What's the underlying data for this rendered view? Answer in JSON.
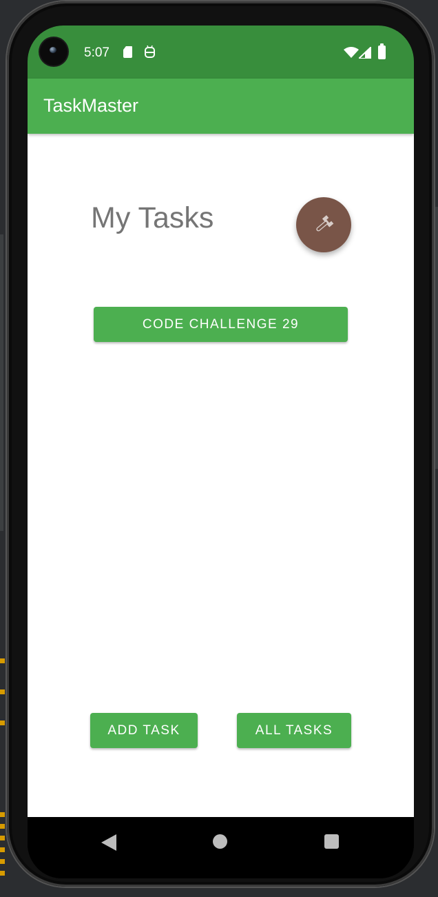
{
  "status_bar": {
    "time": "5:07",
    "icons": [
      "camera-icon",
      "sd-card-icon",
      "robot-icon",
      "wifi-icon",
      "signal-icon",
      "battery-icon"
    ]
  },
  "app_bar": {
    "title": "TaskMaster"
  },
  "main": {
    "heading": "My Tasks",
    "settings_icon": "wrench-icon",
    "challenge_button": "CODE CHALLENGE 29",
    "add_task_button": "ADD TASK",
    "all_tasks_button": "ALL TASKS"
  },
  "nav_bar": {
    "icons": [
      "back-icon",
      "home-icon",
      "recents-icon"
    ]
  },
  "colors": {
    "status_bar": "#388e3c",
    "primary": "#4caf50",
    "fab": "#795548",
    "heading_text": "#757575"
  }
}
